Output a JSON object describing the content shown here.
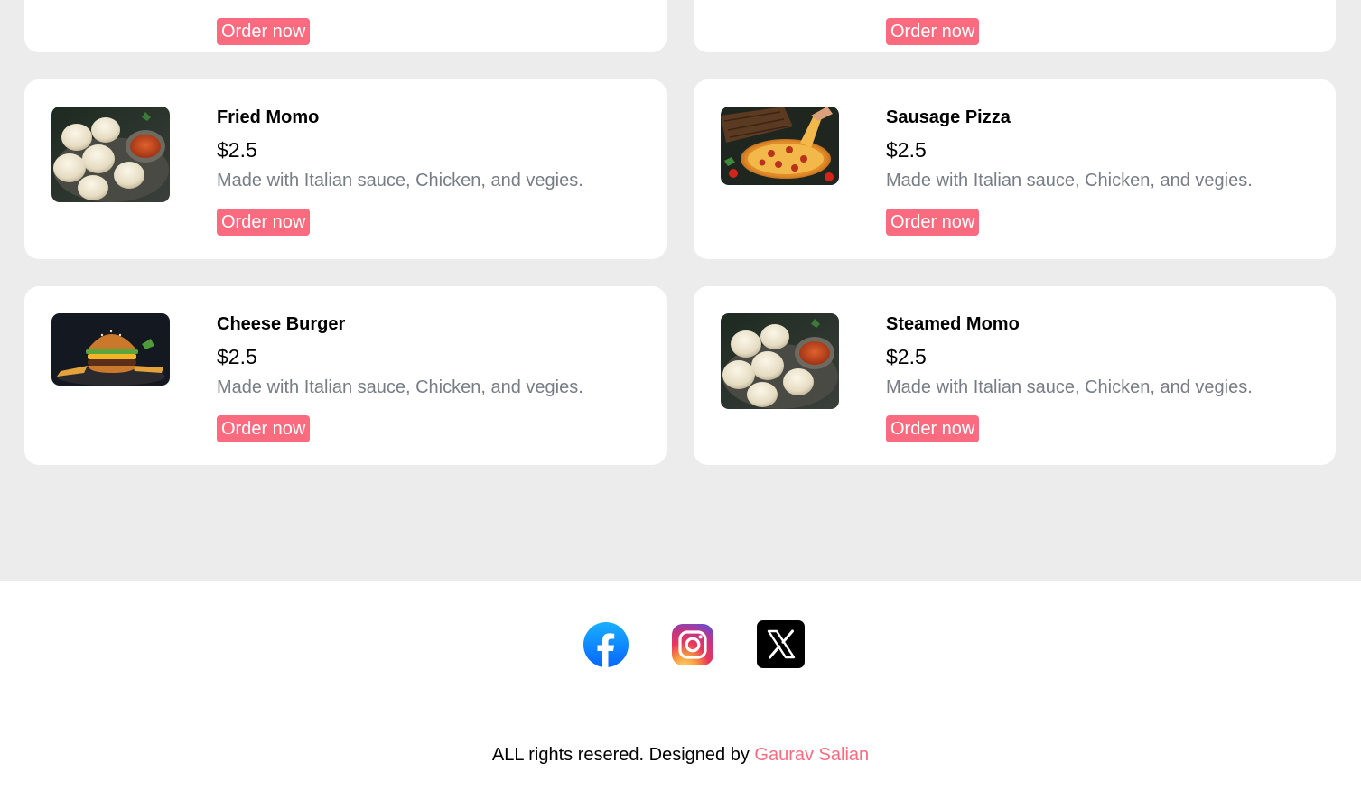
{
  "menu": {
    "top_cards": [
      {
        "order_label": "Order now"
      },
      {
        "order_label": "Order now"
      }
    ],
    "items": [
      {
        "name": "Fried Momo",
        "price": "$2.5",
        "description": "Made with Italian sauce, Chicken, and vegies.",
        "order_label": "Order now",
        "image": "momo-photo"
      },
      {
        "name": "Sausage Pizza",
        "price": "$2.5",
        "description": "Made with Italian sauce, Chicken, and vegies.",
        "order_label": "Order now",
        "image": "pizza-photo"
      },
      {
        "name": "Cheese Burger",
        "price": "$2.5",
        "description": "Made with Italian sauce, Chicken, and vegies.",
        "order_label": "Order now",
        "image": "burger-photo"
      },
      {
        "name": "Steamed Momo",
        "price": "$2.5",
        "description": "Made with Italian sauce, Chicken, and vegies.",
        "order_label": "Order now",
        "image": "momo-photo"
      }
    ]
  },
  "footer": {
    "social": [
      {
        "icon": "facebook-icon"
      },
      {
        "icon": "instagram-icon"
      },
      {
        "icon": "x-twitter-icon"
      }
    ],
    "copyright_prefix": "ALL rights resered. Designed by ",
    "designer": "Gaurav Salian"
  },
  "colors": {
    "accent": "#fb6b80",
    "page_background": "#ececec",
    "card_background": "#ffffff",
    "description_text": "#777d85"
  }
}
